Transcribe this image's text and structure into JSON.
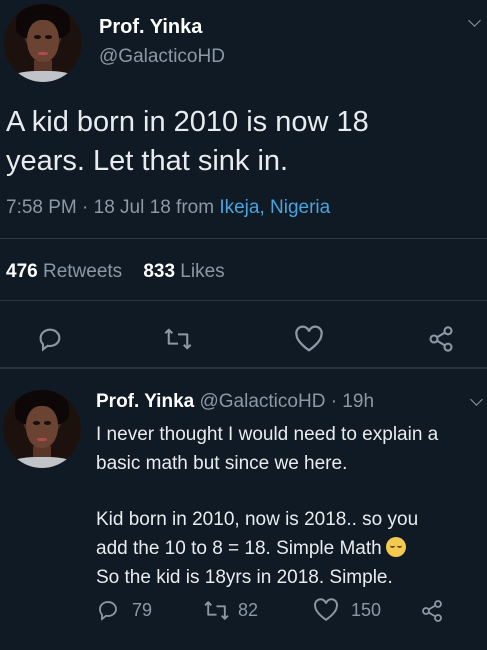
{
  "main_tweet": {
    "display_name": "Prof. Yinka",
    "handle": "@GalacticoHD",
    "text_line1": "A kid born in 2010 is now 18",
    "text_line2": "years. Let that sink in.",
    "time": "7:58 PM · 18 Jul 18 from ",
    "location": "Ikeja, Nigeria",
    "retweets_count": "476",
    "retweets_label": "Retweets",
    "likes_count": "833",
    "likes_label": "Likes"
  },
  "reply_tweet": {
    "display_name": "Prof. Yinka",
    "handle": "@GalacticoHD",
    "age": "· 19h",
    "lines": [
      "I never thought I would need to explain a",
      "basic math but since we here.",
      "",
      "Kid born in 2010, now is 2018.. so you",
      "add the 10 to 8 = 18. Simple Math",
      "So the kid is 18yrs in 2018. Simple."
    ],
    "reply_count": "79",
    "retweet_count": "82",
    "like_count": "150"
  },
  "icons": {
    "reply": "reply-icon",
    "retweet": "retweet-icon",
    "like": "heart-icon",
    "share": "share-icon",
    "menu": "chevron-down-icon"
  },
  "colors": {
    "background": "#101a24",
    "link": "#4aa3df",
    "muted": "#8b98a5"
  }
}
